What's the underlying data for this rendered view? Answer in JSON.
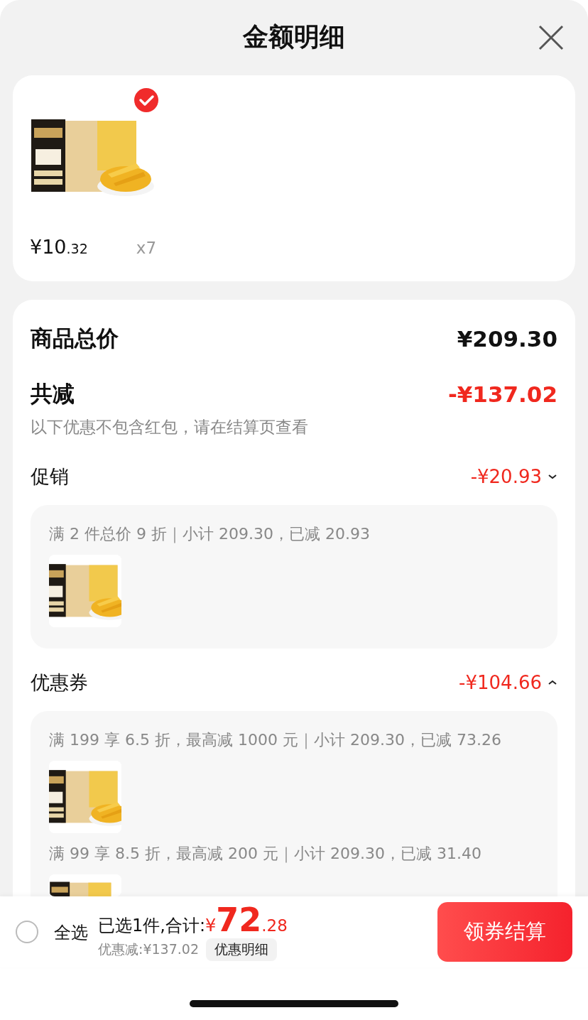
{
  "title": "金额明细",
  "product": {
    "checked": true,
    "price_main": "¥10",
    "price_decimal": ".32",
    "quantity": "x7"
  },
  "summary": {
    "total_label": "商品总价",
    "total_value": "¥209.30",
    "reduce_label": "共减",
    "reduce_value": "-¥137.02",
    "note": "以下优惠不包含红包，请在结算页查看",
    "sections": [
      {
        "label": "促销",
        "value": "-¥20.93",
        "expanded": false,
        "details": [
          {
            "text": "满 2 件总价 9 折｜小计 209.30，已减 20.93"
          }
        ]
      },
      {
        "label": "优惠券",
        "value": "-¥104.66",
        "expanded": true,
        "details": [
          {
            "text": "满 199 享 6.5 折，最高减 1000 元｜小计 209.30，已减 73.26"
          },
          {
            "text": "满 99 享 8.5 折，最高减 200 元｜小计 209.30，已减 31.40"
          }
        ]
      }
    ]
  },
  "bottom_bar": {
    "select_all": {
      "label": "全选",
      "checked": false
    },
    "selected_text": "已选1件,合计:",
    "total_currency": "¥",
    "total_integer": "72",
    "total_decimal": ".28",
    "discount_text": "优惠减:¥137.02",
    "details_button": "优惠明细",
    "checkout_button": "领券结算"
  }
}
